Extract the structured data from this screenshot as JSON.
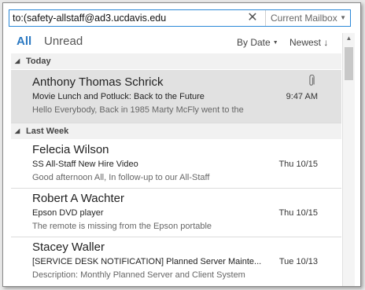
{
  "search": {
    "value": "to:(safety-allstaff@ad3.ucdavis.edu",
    "clear_glyph": "✕",
    "scope": "Current Mailbox"
  },
  "filters": {
    "all": "All",
    "unread": "Unread",
    "sort_by": "By Date",
    "sort_order": "Newest ↓"
  },
  "groups": [
    {
      "label": "Today"
    },
    {
      "label": "Last Week"
    }
  ],
  "messages": [
    {
      "sender": "Anthony Thomas Schrick",
      "subject": "Movie Lunch and Potluck: Back to the Future",
      "preview": "Hello Everybody,  Back in 1985 Marty McFly went to the",
      "date": "9:47 AM",
      "has_attachment": true,
      "selected": true
    },
    {
      "sender": "Felecia Wilson",
      "subject": "SS All-Staff New Hire Video",
      "preview": "Good afternoon All,  In follow-up to our All-Staff",
      "date": "Thu 10/15"
    },
    {
      "sender": "Robert A Wachter",
      "subject": "Epson DVD player",
      "preview": "The remote is missing from the Epson portable",
      "date": "Thu 10/15"
    },
    {
      "sender": "Stacey Waller",
      "subject": "[SERVICE DESK NOTIFICATION] Planned Server Mainte...",
      "preview": "Description:  Monthly Planned Server and Client System",
      "date": "Tue 10/13"
    }
  ],
  "icons": {
    "attachment": "paperclip-icon",
    "collapse": "triangle-icon",
    "dropdown": "chevron-down-icon"
  },
  "colors": {
    "accent": "#2b79c2",
    "search_border": "#2b88d8",
    "selected_bg": "#e1e1e1",
    "group_bg": "#f1f1f1"
  }
}
